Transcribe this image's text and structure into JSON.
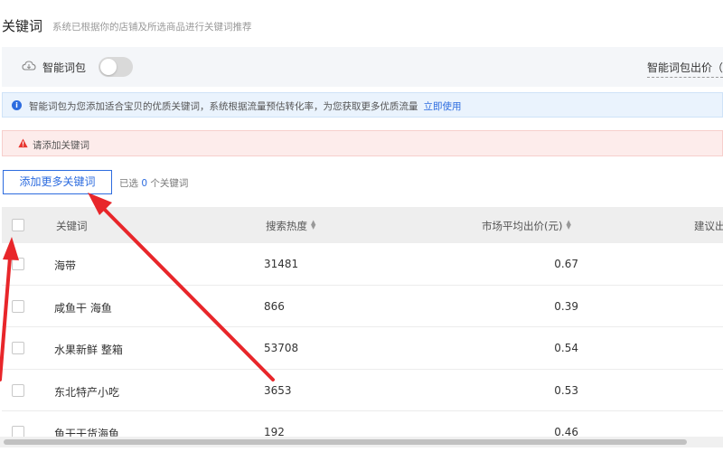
{
  "header": {
    "title": "关键词",
    "subtitle": "系统已根据你的店铺及所选商品进行关键词推荐"
  },
  "smart_bar": {
    "icon": "cloud-icon",
    "label": "智能词包",
    "toggle_on": false,
    "bid_link": "智能词包出价（"
  },
  "info_bar": {
    "icon": "info-icon",
    "text": "智能词包为您添加适合宝贝的优质关键词，系统根据流量预估转化率，为您获取更多优质流量",
    "link": "立即使用"
  },
  "warn_bar": {
    "icon": "warning-icon",
    "text": "请添加关键词"
  },
  "toolbar": {
    "add_button": "添加更多关键词",
    "selected_prefix": "已选",
    "selected_count": "0",
    "selected_suffix": "个关键词"
  },
  "table": {
    "columns": [
      "关键词",
      "搜索热度",
      "市场平均出价(元)",
      "建议出"
    ],
    "rows": [
      {
        "keyword": "海带",
        "heat": "31481",
        "price": "0.67"
      },
      {
        "keyword": "咸鱼干 海鱼",
        "heat": "866",
        "price": "0.39"
      },
      {
        "keyword": "水果新鲜 整箱",
        "heat": "53708",
        "price": "0.54"
      },
      {
        "keyword": "东北特产小吃",
        "heat": "3653",
        "price": "0.53"
      },
      {
        "keyword": "鱼干干货海鱼",
        "heat": "192",
        "price": "0.46"
      }
    ]
  },
  "colors": {
    "accent": "#2d6cdf",
    "arrow": "#e8262a",
    "warning": "#e8362f"
  }
}
